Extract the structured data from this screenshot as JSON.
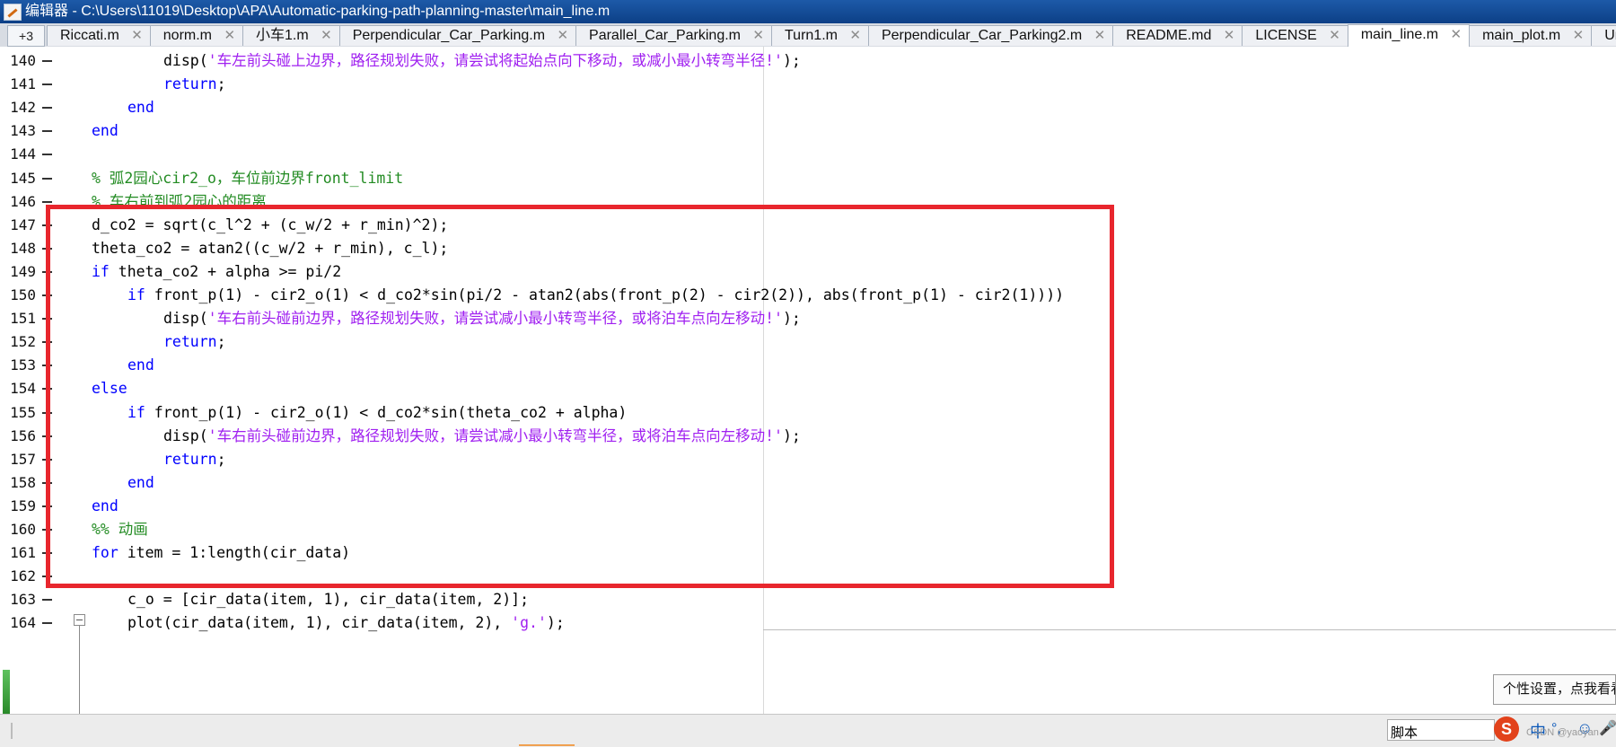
{
  "window": {
    "title": "编辑器 - C:\\Users\\11019\\Desktop\\APA\\Automatic-parking-path-planning-master\\main_line.m"
  },
  "tabbar": {
    "overflow_label": "+3",
    "close_glyph": "✕",
    "tabs": [
      {
        "label": "Riccati.m"
      },
      {
        "label": "norm.m"
      },
      {
        "label": "小车1.m"
      },
      {
        "label": "Perpendicular_Car_Parking.m"
      },
      {
        "label": "Parallel_Car_Parking.m"
      },
      {
        "label": "Turn1.m"
      },
      {
        "label": "Perpendicular_Car_Parking2.m"
      },
      {
        "label": "README.md"
      },
      {
        "label": "LICENSE"
      },
      {
        "label": "main_line.m",
        "active": true
      },
      {
        "label": "main_plot.m"
      },
      {
        "label": "Untitled"
      }
    ]
  },
  "editor": {
    "lines": [
      {
        "no": "140",
        "indent": 3,
        "segs": [
          [
            "n",
            "disp("
          ],
          [
            "s",
            "'车左前头碰上边界，路径规划失败，请尝试将起始点向下移动，或减小最小转弯半径!'"
          ],
          [
            "n",
            ");"
          ]
        ]
      },
      {
        "no": "141",
        "indent": 3,
        "segs": [
          [
            "k",
            "return"
          ],
          [
            "n",
            ";"
          ]
        ]
      },
      {
        "no": "142",
        "indent": 2,
        "segs": [
          [
            "k",
            "end"
          ]
        ]
      },
      {
        "no": "143",
        "indent": 1,
        "segs": [
          [
            "k",
            "end"
          ]
        ]
      },
      {
        "no": "144",
        "indent": 0,
        "segs": []
      },
      {
        "no": "145",
        "indent": 1,
        "segs": [
          [
            "c",
            "% 弧2园心cir2_o，车位前边界front_limit"
          ]
        ]
      },
      {
        "no": "146",
        "indent": 1,
        "segs": [
          [
            "c",
            "% 车右前到弧2园心的距离"
          ]
        ]
      },
      {
        "no": "147",
        "indent": 1,
        "segs": [
          [
            "n",
            "d_co2 = sqrt(c_l^2 + (c_w/2 + r_min)^2);"
          ]
        ]
      },
      {
        "no": "148",
        "indent": 1,
        "segs": [
          [
            "n",
            "theta_co2 = atan2((c_w/2 + r_min), c_l);"
          ]
        ]
      },
      {
        "no": "149",
        "indent": 1,
        "segs": [
          [
            "k",
            "if"
          ],
          [
            "n",
            " theta_co2 + alpha >= pi/2"
          ]
        ]
      },
      {
        "no": "150",
        "indent": 2,
        "segs": [
          [
            "k",
            "if"
          ],
          [
            "n",
            " front_p(1) - cir2_o(1) < d_co2*sin(pi/2 - atan2(abs(front_p(2) - cir2(2)), abs(front_p(1) - cir2(1))))"
          ]
        ]
      },
      {
        "no": "151",
        "indent": 3,
        "segs": [
          [
            "n",
            "disp("
          ],
          [
            "s",
            "'车右前头碰前边界，路径规划失败，请尝试减小最小转弯半径，或将泊车点向左移动!'"
          ],
          [
            "n",
            ");"
          ]
        ]
      },
      {
        "no": "152",
        "indent": 3,
        "segs": [
          [
            "k",
            "return"
          ],
          [
            "n",
            ";"
          ]
        ]
      },
      {
        "no": "153",
        "indent": 2,
        "segs": [
          [
            "k",
            "end"
          ]
        ]
      },
      {
        "no": "154",
        "indent": 1,
        "segs": [
          [
            "k",
            "else"
          ]
        ]
      },
      {
        "no": "155",
        "indent": 2,
        "segs": [
          [
            "k",
            "if"
          ],
          [
            "n",
            " front_p(1) - cir2_o(1) < d_co2*sin(theta_co2 + alpha)"
          ]
        ]
      },
      {
        "no": "156",
        "indent": 3,
        "segs": [
          [
            "n",
            "disp("
          ],
          [
            "s",
            "'车右前头碰前边界，路径规划失败，请尝试减小最小转弯半径，或将泊车点向左移动!'"
          ],
          [
            "n",
            ");"
          ]
        ]
      },
      {
        "no": "157",
        "indent": 3,
        "segs": [
          [
            "k",
            "return"
          ],
          [
            "n",
            ";"
          ]
        ]
      },
      {
        "no": "158",
        "indent": 2,
        "segs": [
          [
            "k",
            "end"
          ]
        ]
      },
      {
        "no": "159",
        "indent": 1,
        "segs": [
          [
            "k",
            "end"
          ]
        ]
      },
      {
        "no": "160",
        "indent": 1,
        "segs": [
          [
            "c",
            "%% 动画"
          ]
        ]
      },
      {
        "no": "161",
        "indent": 1,
        "segs": [
          [
            "k",
            "for"
          ],
          [
            "n",
            " item = 1:length(cir_data)"
          ]
        ]
      },
      {
        "no": "162",
        "indent": 0,
        "segs": []
      },
      {
        "no": "163",
        "indent": 2,
        "segs": [
          [
            "n",
            "c_o = [cir_data(item, 1), cir_data(item, 2)];"
          ]
        ]
      },
      {
        "no": "164",
        "indent": 2,
        "segs": [
          [
            "n",
            "plot(cir_data(item, 1), cir_data(item, 2), "
          ],
          [
            "s",
            "'g.'"
          ],
          [
            "n",
            ");"
          ]
        ]
      }
    ]
  },
  "status": {
    "mode": "脚本"
  },
  "tooltip": {
    "text": "个性设置，点我看看"
  },
  "ime": {
    "logo": "S",
    "lang": "中",
    "dot": "°,",
    "emoji": "☺",
    "mic": "🎤"
  },
  "watermark": {
    "text": "CSDN @yaoyan"
  },
  "colors": {
    "keyword": "#0000ff",
    "comment": "#228b22",
    "string": "#a020f0",
    "highlight_box": "#e8262d",
    "titlebar": "#0c3f86"
  }
}
